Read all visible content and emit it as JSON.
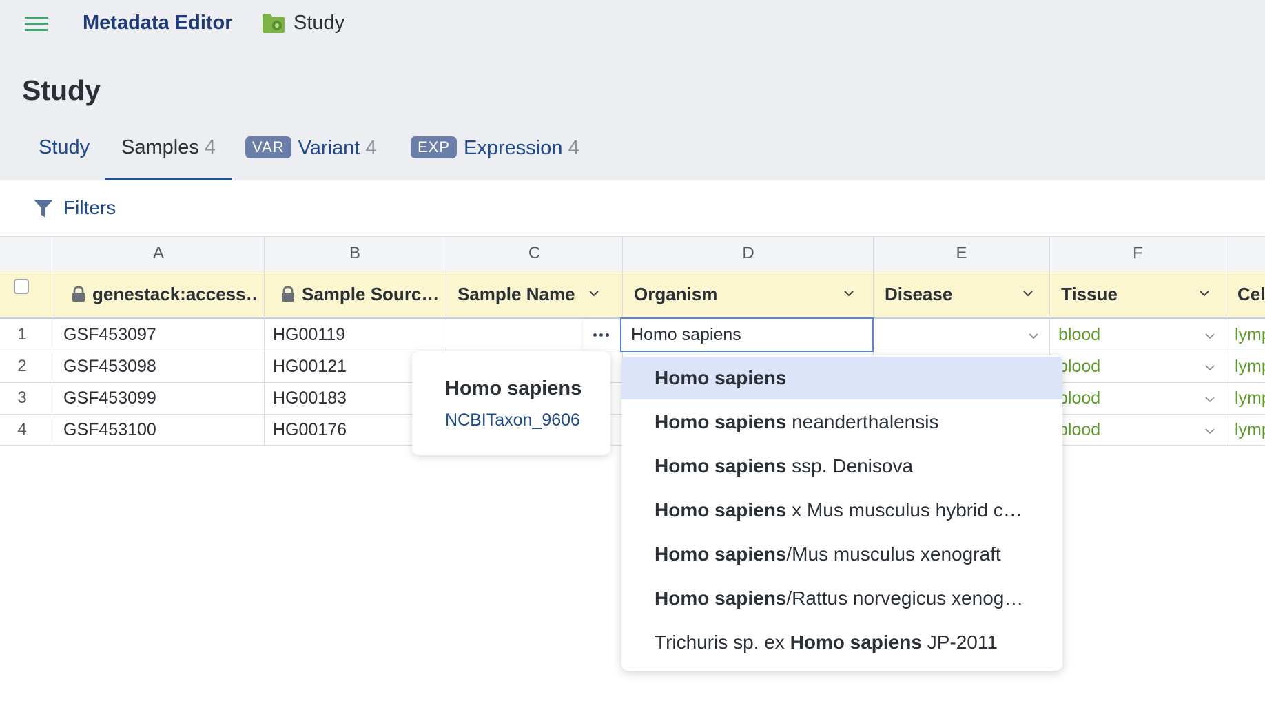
{
  "header": {
    "app_title": "Metadata Editor",
    "breadcrumb": "Study",
    "page_title": "Study"
  },
  "tabs": [
    {
      "label": "Study",
      "count": ""
    },
    {
      "label": "Samples",
      "count": "4"
    },
    {
      "badge": "VAR",
      "label": "Variant",
      "count": "4"
    },
    {
      "badge": "EXP",
      "label": "Expression",
      "count": "4"
    }
  ],
  "toolbar": {
    "filters_label": "Filters"
  },
  "grid": {
    "column_letters": [
      "A",
      "B",
      "C",
      "D",
      "E",
      "F"
    ],
    "headers": [
      {
        "label": "genestack:access…",
        "locked": true
      },
      {
        "label": "Sample Sourc…",
        "locked": true
      },
      {
        "label": "Sample Name"
      },
      {
        "label": "Organism"
      },
      {
        "label": "Disease"
      },
      {
        "label": "Tissue"
      },
      {
        "label": "Cel"
      }
    ],
    "rows": [
      {
        "num": "1",
        "accession": "GSF453097",
        "source": "HG00119",
        "tissue": "blood",
        "cell": "lymp"
      },
      {
        "num": "2",
        "accession": "GSF453098",
        "source": "HG00121",
        "tissue": "blood",
        "cell": "lymp"
      },
      {
        "num": "3",
        "accession": "GSF453099",
        "source": "HG00183",
        "tissue": "blood",
        "cell": "lymp"
      },
      {
        "num": "4",
        "accession": "GSF453100",
        "source": "HG00176",
        "tissue": "blood",
        "cell": "lymp"
      }
    ]
  },
  "editor": {
    "value": "Homo sapiens"
  },
  "tooltip": {
    "name": "Homo sapiens",
    "id": "NCBITaxon_9606"
  },
  "dropdown": {
    "options": [
      {
        "pre": "",
        "bold": "Homo sapiens",
        "post": ""
      },
      {
        "pre": "",
        "bold": "Homo sapiens",
        "post": " neanderthalensis"
      },
      {
        "pre": "",
        "bold": "Homo sapiens",
        "post": " ssp. Denisova"
      },
      {
        "pre": "",
        "bold": "Homo sapiens",
        "post": " x Mus musculus hybrid c…"
      },
      {
        "pre": "",
        "bold": "Homo sapiens",
        "post": "/Mus musculus xenograft"
      },
      {
        "pre": "",
        "bold": "Homo sapiens",
        "post": "/Rattus norvegicus xenog…"
      },
      {
        "pre": "Trichuris sp. ex ",
        "bold": "Homo sapiens",
        "post": " JP-2011"
      }
    ],
    "selected_index": 0
  },
  "colors": {
    "accent": "#1e4a8f",
    "header_bg": "#fbf6cf",
    "selected_option_bg": "#dbe4f9",
    "term_green": "#5d9b29"
  },
  "icons": [
    "hamburger-menu-icon",
    "folder-icon",
    "filter-icon",
    "lock-icon",
    "chevron-down-icon",
    "more-dots-icon"
  ]
}
